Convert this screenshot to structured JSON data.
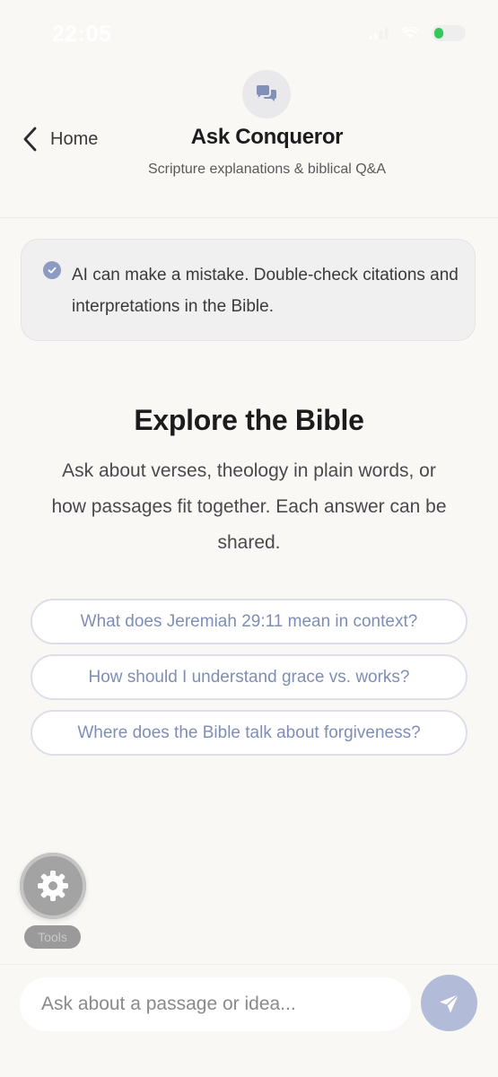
{
  "status_bar": {
    "time": "22:05"
  },
  "header": {
    "back_label": "Home",
    "title": "Ask Conqueror",
    "subtitle": "Scripture explanations & biblical Q&A",
    "badge_icon": "chat-bubbles-icon"
  },
  "disclaimer": {
    "text": "AI can make a mistake. Double-check citations and interpretations in the Bible.",
    "icon": "check-circle-icon"
  },
  "explore": {
    "title": "Explore the Bible",
    "description": "Ask about verses, theology in plain words, or how passages fit together. Each answer can be shared."
  },
  "suggestions": [
    "What does Jeremiah 29:11 mean in context?",
    "How should I understand grace vs. works?",
    "Where does the Bible talk about forgiveness?"
  ],
  "tools": {
    "label": "Tools",
    "icon": "gear-icon"
  },
  "composer": {
    "placeholder": "Ask about a passage or idea...",
    "send_icon": "paper-plane-icon"
  },
  "colors": {
    "background": "#f9f8f5",
    "accent": "#7f8eb6",
    "send_button": "#b2bcd8",
    "battery_green": "#34c759"
  }
}
